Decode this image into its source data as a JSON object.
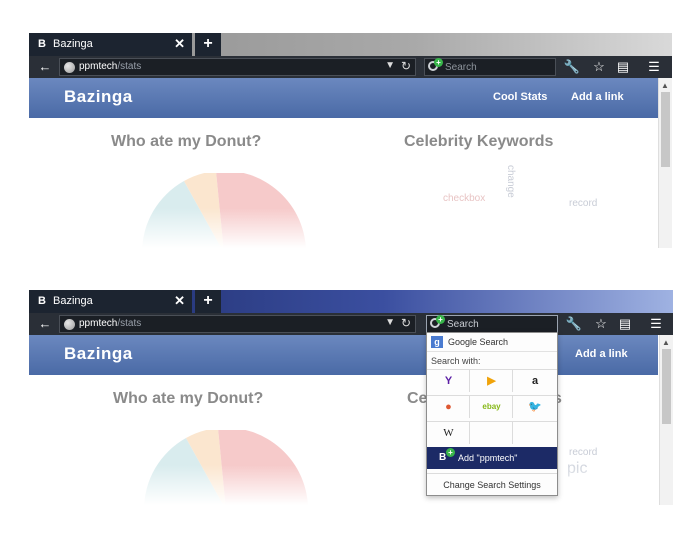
{
  "tab": {
    "favicon": "B",
    "title": "Bazinga",
    "close": "✕",
    "new_tab": "+"
  },
  "nav": {
    "back": "←",
    "url_host": "ppmtech",
    "url_path": "/stats",
    "dropdown": "▼",
    "reload": "↻"
  },
  "search": {
    "placeholder": "Search",
    "add_badge": "+"
  },
  "toolbar_icons": [
    "wrench-icon",
    "star-icon",
    "clipboard-icon",
    "menu-icon"
  ],
  "page": {
    "logo": "Bazinga",
    "nav_links": [
      "Cool Stats",
      "Add a link"
    ],
    "section_left": "Who ate my Donut?",
    "section_right": "Celebrity Keywords",
    "section_right_partial": "Ce",
    "section_right_partial_end": "s",
    "cloud_words": [
      "change",
      "record",
      "checkbox",
      "pic"
    ]
  },
  "dropdown": {
    "google": "Google Search",
    "search_with": "Search with:",
    "engines": [
      {
        "name": "yahoo-icon",
        "glyph": "Y",
        "color": "#5b1ea5"
      },
      {
        "name": "bing-icon",
        "glyph": "▶",
        "color": "#f0a30a"
      },
      {
        "name": "amazon-icon",
        "glyph": "a",
        "color": "#222222"
      },
      {
        "name": "duckduckgo-icon",
        "glyph": "●",
        "color": "#de5833"
      },
      {
        "name": "ebay-icon",
        "glyph": "ebay",
        "color": "#86b817"
      },
      {
        "name": "twitter-icon",
        "glyph": "🐦",
        "color": "#1da1f2"
      },
      {
        "name": "wikipedia-icon",
        "glyph": "W",
        "color": "#222222"
      }
    ],
    "add_engine": "Add \"ppmtech\"",
    "add_badge": "B",
    "settings": "Change Search Settings"
  },
  "colors": {
    "header_blue": "#4a6aa6",
    "dark_chrome": "#2a2f37",
    "dropdown_highlight": "#1c2a66"
  }
}
